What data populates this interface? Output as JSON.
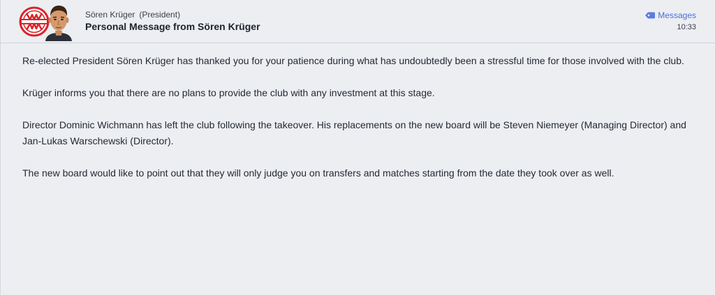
{
  "header": {
    "sender_name": "Sören Krüger",
    "sender_role": "(President)",
    "subject": "Personal Message from Sören Krüger",
    "messages_link_label": "Messages",
    "time": "10:33",
    "club_logo_icon": "club-crest-icon",
    "avatar_icon": "player-face-icon"
  },
  "colors": {
    "accent": "#4a6fd8",
    "crest_red": "#d9242a"
  },
  "message": {
    "paragraphs": [
      "Re-elected President Sören Krüger has thanked you for your patience during what has undoubtedly been a stressful time for those involved with the club.",
      "Krüger informs you that there are no plans to provide the club with any investment at this stage.",
      "Director Dominic Wichmann has left the club following the takeover. His replacements on the new board will be Steven Niemeyer (Managing Director) and Jan-Lukas Warschewski (Director).",
      "The new board would like to point out that they will only judge you on transfers and matches starting from the date they took over as well."
    ]
  }
}
